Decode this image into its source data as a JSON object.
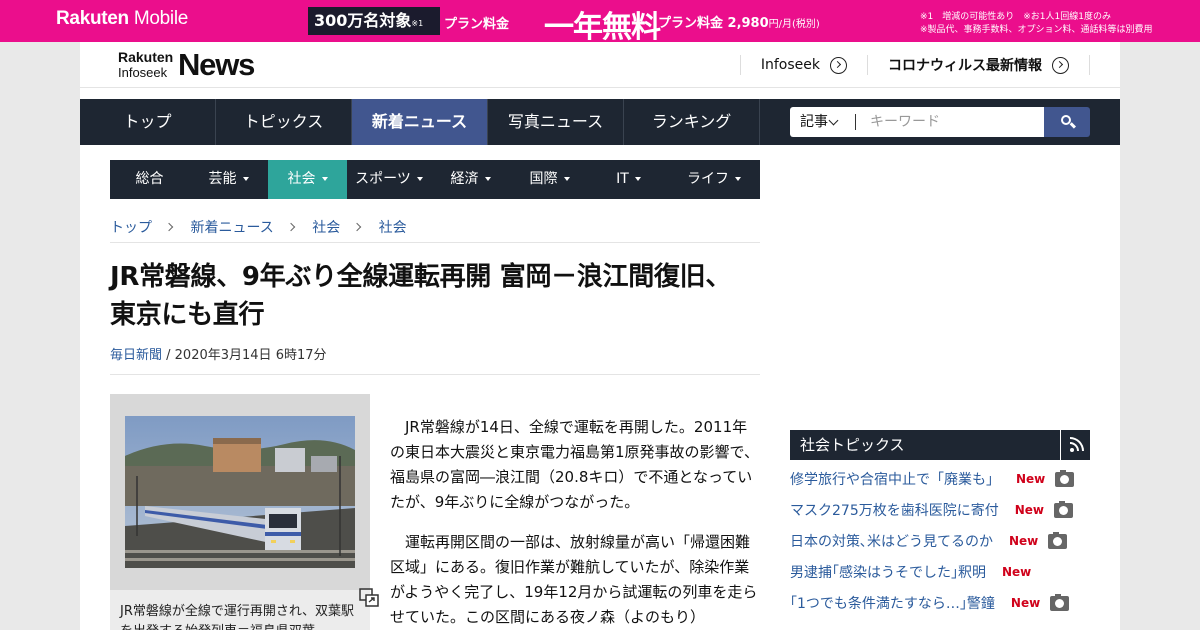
{
  "ad": {
    "brand_bold": "Rakuten",
    "brand_rest": "Mobile",
    "pill": "300万名対象",
    "pill_note": "※1",
    "plan_label": "プラン料金",
    "free": "一年無料",
    "plan_price": "プラン料金 2,980",
    "plan_unit": "円/月(税別)",
    "note1": "※1　増減の可能性あり　※お1人1回線1度のみ",
    "note2": "※製品代、事務手数料、オプション料、通話料等は別費用"
  },
  "header": {
    "logo_top": "Rakuten",
    "logo_bottom": "Infoseek",
    "logo_news": "News",
    "link1": "Infoseek",
    "link2": "コロナウィルス最新情報"
  },
  "mainnav": {
    "items": [
      "トップ",
      "トピックス",
      "新着ニュース",
      "写真ニュース",
      "ランキング"
    ]
  },
  "search": {
    "category": "記事",
    "placeholder": "キーワード"
  },
  "subnav": {
    "items": [
      "総合",
      "芸能",
      "社会",
      "スポーツ",
      "経済",
      "国際",
      "IT",
      "ライフ"
    ]
  },
  "breadcrumb": [
    "トップ",
    "新着ニュース",
    "社会",
    "社会"
  ],
  "article": {
    "title": "JR常磐線、9年ぶり全線運転再開 富岡－浪江間復旧、東京にも直行",
    "source": "毎日新聞",
    "date": " / 2020年3月14日 6時17分",
    "caption": "JR常磐線が全線で運行再開され、双葉駅を出発する始発列車＝福島県双葉",
    "paragraphs": [
      "JR常磐線が14日、全線で運転を再開した。2011年の東日本大震災と東京電力福島第1原発事故の影響で、福島県の富岡―浪江間（20.8キロ）で不通となっていたが、9年ぶりに全線がつながった。",
      "運転再開区間の一部は、放射線量が高い「帰還困難区域」にある。復旧作業が難航していたが、除染作業がようやく完了し、19年12月から試運転の列車を走らせていた。この区間にある夜ノ森（よのもり）"
    ]
  },
  "sidebar": {
    "heading": "社会トピックス",
    "topics": [
      {
        "text": "修学旅行や合宿中止で「廃業も」",
        "new": "New",
        "photo": true
      },
      {
        "text": "マスク275万枚を歯科医院に寄付",
        "new": "New",
        "photo": true
      },
      {
        "text": "日本の対策､米はどう見てるのか",
        "new": "New",
        "photo": true
      },
      {
        "text": "男逮捕｢感染はうそでした｣釈明",
        "new": "New",
        "photo": false
      },
      {
        "text": "｢1つでも条件満たすなら…｣警鐘",
        "new": "New",
        "photo": true
      }
    ]
  },
  "colors": {
    "ad_pink": "#eb0e8c",
    "nav_dark": "#1e2632",
    "nav_active": "#41568f",
    "subnav_active": "#2ea59b",
    "link_blue": "#2b5b9c",
    "new_red": "#d0021b"
  }
}
